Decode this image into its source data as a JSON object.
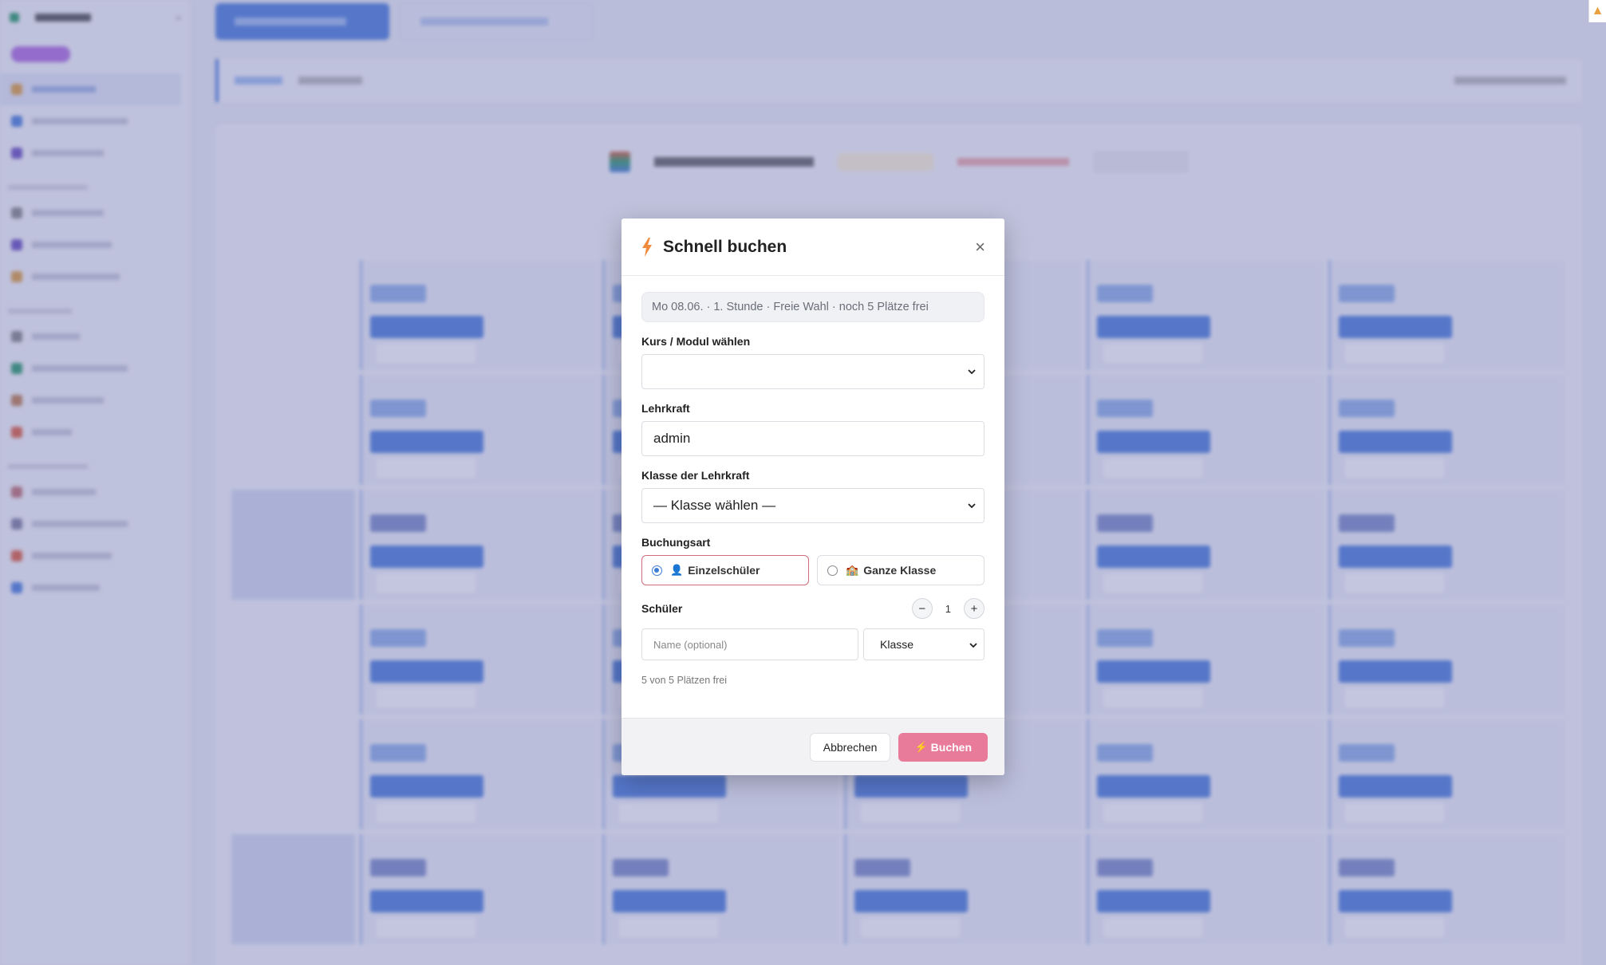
{
  "modal": {
    "title": "Schnell buchen",
    "info": "Mo 08.06. · 1. Stunde · Freie Wahl · noch 5 Plätze frei",
    "course_label": "Kurs / Modul wählen",
    "course_value": "",
    "teacher_label": "Lehrkraft",
    "teacher_value": "admin",
    "class_label": "Klasse der Lehrkraft",
    "class_value": "— Klasse wählen —",
    "booking_type_label": "Buchungsart",
    "option_single": "Einzelschüler",
    "option_single_icon": "👤",
    "option_class": "Ganze Klasse",
    "option_class_icon": "🏫",
    "students_label": "Schüler",
    "students_count": "1",
    "minus": "−",
    "plus": "+",
    "name_placeholder": "Name (optional)",
    "student_class_value": "Klasse",
    "free_text": "5 von 5 Plätzen frei",
    "cancel": "Abbrechen",
    "book_icon": "⚡",
    "book": "Buchen",
    "close": "×"
  },
  "colors": {
    "accent": "#4d7fdc",
    "book_button": "#e87a9a",
    "selected_border": "#d16c7c",
    "overlay": "#6469aa"
  }
}
